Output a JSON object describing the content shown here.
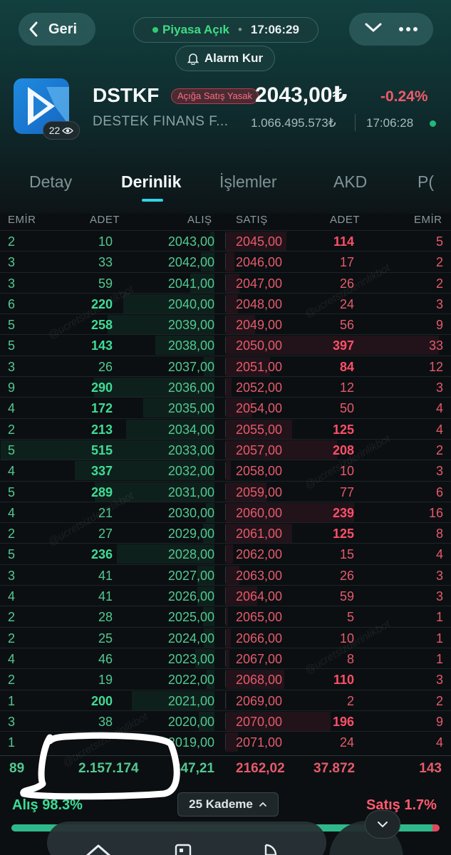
{
  "header": {
    "back_label": "Geri",
    "market_status": "Piyasa Açık",
    "market_time": "17:06:29",
    "alarm_label": "Alarm Kur",
    "symbol": "DSTKF",
    "short_sale_badge": "Açığa Satış Yasak",
    "price": "2043,00₺",
    "change": "-0.24%",
    "company_name": "DESTEK FINANS F...",
    "volume": "1.066.495.573₺",
    "last_time": "17:06:28",
    "viewers": "22",
    "colors": {
      "accent": "#32d2e8",
      "buy": "#52c991",
      "sell": "#e65a6b",
      "logo": "#1f8be0"
    }
  },
  "tabs": [
    {
      "label": "Detay"
    },
    {
      "label": "Derinlik",
      "active": true
    },
    {
      "label": "İşlemler"
    },
    {
      "label": "AKD"
    },
    {
      "label": "P("
    }
  ],
  "depth": {
    "columns": {
      "bid_orders": "EMİR",
      "bid_qty": "ADET",
      "bid_price": "ALIŞ",
      "ask_price": "SATIŞ",
      "ask_qty": "ADET",
      "ask_orders": "EMİR"
    },
    "rows": [
      {
        "bo": "2",
        "bq": "10",
        "bp": "2043,00",
        "ap": "2045,00",
        "aq": "114",
        "ao": "5"
      },
      {
        "bo": "3",
        "bq": "33",
        "bp": "2042,00",
        "ap": "2046,00",
        "aq": "17",
        "ao": "2"
      },
      {
        "bo": "3",
        "bq": "59",
        "bp": "2041,00",
        "ap": "2047,00",
        "aq": "26",
        "ao": "2"
      },
      {
        "bo": "6",
        "bq": "220",
        "bp": "2040,00",
        "ap": "2048,00",
        "aq": "24",
        "ao": "3"
      },
      {
        "bo": "5",
        "bq": "258",
        "bp": "2039,00",
        "ap": "2049,00",
        "aq": "56",
        "ao": "9"
      },
      {
        "bo": "5",
        "bq": "143",
        "bp": "2038,00",
        "ap": "2050,00",
        "aq": "397",
        "ao": "33"
      },
      {
        "bo": "3",
        "bq": "26",
        "bp": "2037,00",
        "ap": "2051,00",
        "aq": "84",
        "ao": "12"
      },
      {
        "bo": "9",
        "bq": "290",
        "bp": "2036,00",
        "ap": "2052,00",
        "aq": "12",
        "ao": "3"
      },
      {
        "bo": "4",
        "bq": "172",
        "bp": "2035,00",
        "ap": "2054,00",
        "aq": "50",
        "ao": "4"
      },
      {
        "bo": "2",
        "bq": "213",
        "bp": "2034,00",
        "ap": "2055,00",
        "aq": "125",
        "ao": "4"
      },
      {
        "bo": "5",
        "bq": "515",
        "bp": "2033,00",
        "ap": "2057,00",
        "aq": "208",
        "ao": "2"
      },
      {
        "bo": "4",
        "bq": "337",
        "bp": "2032,00",
        "ap": "2058,00",
        "aq": "10",
        "ao": "3"
      },
      {
        "bo": "5",
        "bq": "289",
        "bp": "2031,00",
        "ap": "2059,00",
        "aq": "77",
        "ao": "6"
      },
      {
        "bo": "4",
        "bq": "21",
        "bp": "2030,00",
        "ap": "2060,00",
        "aq": "239",
        "ao": "16"
      },
      {
        "bo": "2",
        "bq": "27",
        "bp": "2029,00",
        "ap": "2061,00",
        "aq": "125",
        "ao": "8"
      },
      {
        "bo": "5",
        "bq": "236",
        "bp": "2028,00",
        "ap": "2062,00",
        "aq": "15",
        "ao": "4"
      },
      {
        "bo": "3",
        "bq": "41",
        "bp": "2027,00",
        "ap": "2063,00",
        "aq": "26",
        "ao": "3"
      },
      {
        "bo": "4",
        "bq": "41",
        "bp": "2026,00",
        "ap": "2064,00",
        "aq": "59",
        "ao": "3"
      },
      {
        "bo": "2",
        "bq": "28",
        "bp": "2025,00",
        "ap": "2065,00",
        "aq": "5",
        "ao": "1"
      },
      {
        "bo": "2",
        "bq": "25",
        "bp": "2024,00",
        "ap": "2066,00",
        "aq": "10",
        "ao": "1"
      },
      {
        "bo": "4",
        "bq": "46",
        "bp": "2023,00",
        "ap": "2067,00",
        "aq": "8",
        "ao": "1"
      },
      {
        "bo": "2",
        "bq": "19",
        "bp": "2022,00",
        "ap": "2068,00",
        "aq": "110",
        "ao": "3"
      },
      {
        "bo": "1",
        "bq": "200",
        "bp": "2021,00",
        "ap": "2069,00",
        "aq": "2",
        "ao": "2"
      },
      {
        "bo": "3",
        "bq": "38",
        "bp": "2020,00",
        "ap": "2070,00",
        "aq": "196",
        "ao": "9"
      },
      {
        "bo": "1",
        "bq": "",
        "bp": "2019,00",
        "ap": "2071,00",
        "aq": "24",
        "ao": "4"
      }
    ],
    "totals": {
      "bid_orders": "89",
      "bid_qty": "2.157.174",
      "bid_avg": "847,21",
      "ask_avg": "2162,02",
      "ask_qty": "37.872",
      "ask_orders": "143"
    }
  },
  "footer": {
    "buy_ratio_label": "Alış 98.3%",
    "sell_ratio_label": "Satış 1.7%",
    "buy_ratio": 0.983,
    "levels_label": "25 Kademe"
  },
  "watermark": "@ucretsizderinlikbot"
}
